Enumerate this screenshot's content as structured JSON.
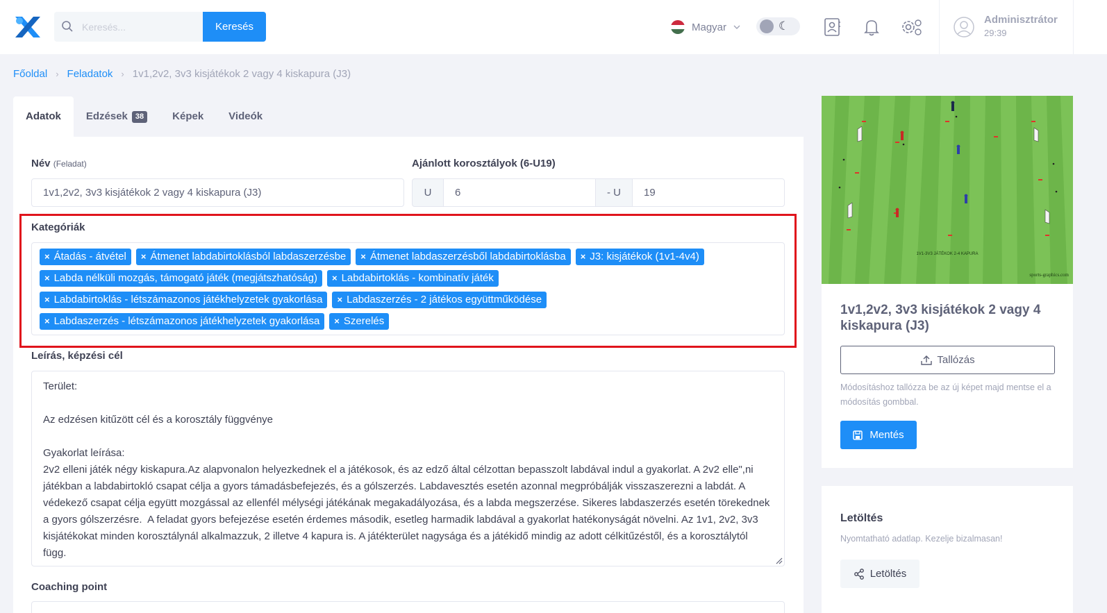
{
  "header": {
    "logo_icon": "x-logo-icon",
    "search": {
      "placeholder": "Keresés...",
      "button_label": "Keresés"
    },
    "language": {
      "label": "Magyar",
      "flag_colors": [
        "#cd2a3e",
        "#ffffff",
        "#436f4d"
      ]
    },
    "icons": [
      "contacts-icon",
      "bell-icon",
      "settings-icon"
    ],
    "user": {
      "name": "Adminisztrátor",
      "time": "29:39"
    }
  },
  "breadcrumb": {
    "home": "Főoldal",
    "section": "Feladatok",
    "current": "1v1,2v2, 3v3 kisjátékok 2 vagy 4 kiskapura (J3)"
  },
  "tabs": [
    {
      "label": "Adatok",
      "active": true
    },
    {
      "label": "Edzések",
      "badge": "38"
    },
    {
      "label": "Képek"
    },
    {
      "label": "Videók"
    }
  ],
  "form": {
    "name_label": "Név",
    "name_sub": "(Feladat)",
    "name_value": "1v1,2v2, 3v3 kisjátékok 2 vagy 4 kiskapura (J3)",
    "age_label": "Ajánlott korosztályok (6-U19)",
    "age_prefix_from": "U",
    "age_from": "6",
    "age_prefix_to": "- U",
    "age_to": "19",
    "categories_label": "Kategóriák",
    "categories": [
      "Átadás - átvétel",
      "Átmenet labdabirtoklásból labdaszerzésbe",
      "Átmenet labdaszerzésből labdabirtoklásba",
      "J3: kisjátékok (1v1-4v4)",
      "Labda nélküli mozgás, támogató játék (megjátszhatóság)",
      "Labdabirtoklás - kombinatív játék",
      "Labdabirtoklás - létszámazonos játékhelyzetek gyakorlása",
      "Labdaszerzés - 2 játékos együttműködése",
      "Labdaszerzés - létszámazonos játékhelyzetek gyakorlása",
      "Szerelés"
    ],
    "tag_remove": "×",
    "description_label": "Leírás, képzési cél",
    "description": "Terület:\n\nAz edzésen kitűzött cél és a korosztály függvénye\n\nGyakorlat leírása:\n2v2 elleni játék négy kiskapura.Az alapvonalon helyezkednek el a játékosok, és az edző által célzottan bepasszolt labdával indul a gyakorlat. A 2v2 elle\",ni játékban a labdabirtokló csapat célja a gyors támadásbefejezés, és a gólszerzés. Labdavesztés esetén azonnal megpróbálják visszaszerezni a labdát. A védekező csapat célja együtt mozgással az ellenfél mélységi játékának megakadályozása, és a labda megszerzése. Sikeres labdaszerzés esetén törekednek a gyors gólszerzésre.  A feladat gyors befejezése esetén érdemes második, esetleg harmadik labdával a gyakorlat hatékonyságát növelni. Az 1v1, 2v2, 3v3 kisjátékokat minden korosztálynál alkalmazzuk, 2 illetve 4 kapura is. A játékterület nagysága és a játékidő mindig az adott célkitűzéstől, és a korosztálytól függ.",
    "coaching_label": "Coaching point"
  },
  "side": {
    "image_caption": "1V1-3V3 JÁTÉKOK 2-4 KAPURA",
    "image_credit": "sports-graphics.com",
    "title": "1v1,2v2, 3v3 kisjátékok 2 vagy 4 kiskapura (J3)",
    "browse_label": "Tallózás",
    "hint": "Módosításhoz tallózza be az új képet majd mentse el a módosítás gombbal.",
    "save_label": "Mentés"
  },
  "download": {
    "title": "Letöltés",
    "subtitle": "Nyomtatható adatlap. Kezelje bizalmasan!",
    "button_label": "Letöltés"
  },
  "colors": {
    "accent": "#1e8ef7",
    "highlight": "#e0141c",
    "pitch": "#6db54a"
  }
}
